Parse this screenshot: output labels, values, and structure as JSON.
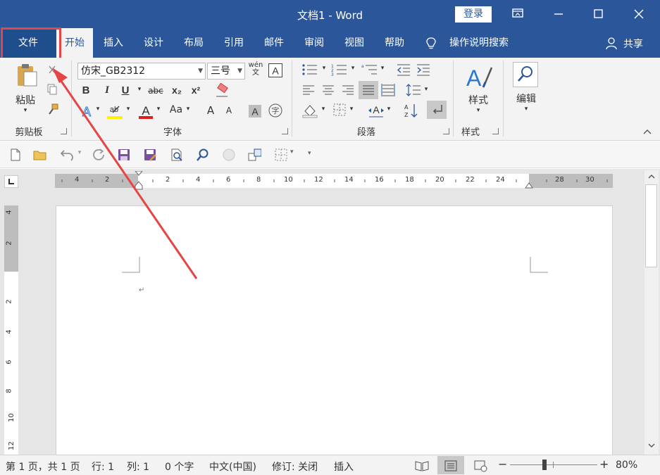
{
  "window": {
    "title": "文档1 - Word",
    "login_label": "登录"
  },
  "tabs": [
    {
      "label": "文件"
    },
    {
      "label": "开始"
    },
    {
      "label": "插入"
    },
    {
      "label": "设计"
    },
    {
      "label": "布局"
    },
    {
      "label": "引用"
    },
    {
      "label": "邮件"
    },
    {
      "label": "审阅"
    },
    {
      "label": "视图"
    },
    {
      "label": "帮助"
    },
    {
      "label": "操作说明搜索"
    }
  ],
  "share_label": "共享",
  "ribbon": {
    "clipboard": {
      "paste_label": "粘贴",
      "group_label": "剪贴板"
    },
    "font": {
      "font_name": "仿宋_GB2312",
      "font_size": "三号",
      "phonetic_label": "wén\n文",
      "bold": "B",
      "italic": "I",
      "underline": "U",
      "strike": "abc",
      "subscript": "x₂",
      "superscript": "x²",
      "grow": "A",
      "shrink": "A",
      "case": "Aa",
      "group_label": "字体"
    },
    "paragraph": {
      "group_label": "段落"
    },
    "styles": {
      "label": "样式",
      "group_label": "样式"
    },
    "editing": {
      "label": "编辑"
    }
  },
  "ruler": {
    "h_labels": [
      "4",
      "2",
      "2",
      "4",
      "6",
      "8",
      "10",
      "12",
      "14",
      "16",
      "18",
      "20",
      "22",
      "24",
      "28",
      "30"
    ],
    "v_labels": [
      "4",
      "2",
      "2",
      "4",
      "6",
      "8",
      "10",
      "12"
    ]
  },
  "statusbar": {
    "page": "第 1 页，共 1 页",
    "line": "行: 1",
    "column": "列: 1",
    "words": "0 个字",
    "language": "中文(中国)",
    "track": "修订: 关闭",
    "mode": "插入",
    "zoom": "80%"
  },
  "colors": {
    "accent": "#2b579a",
    "highlight": "#e64545",
    "font_red": "#e01d1d",
    "highlight_yellow": "#ffef00"
  }
}
